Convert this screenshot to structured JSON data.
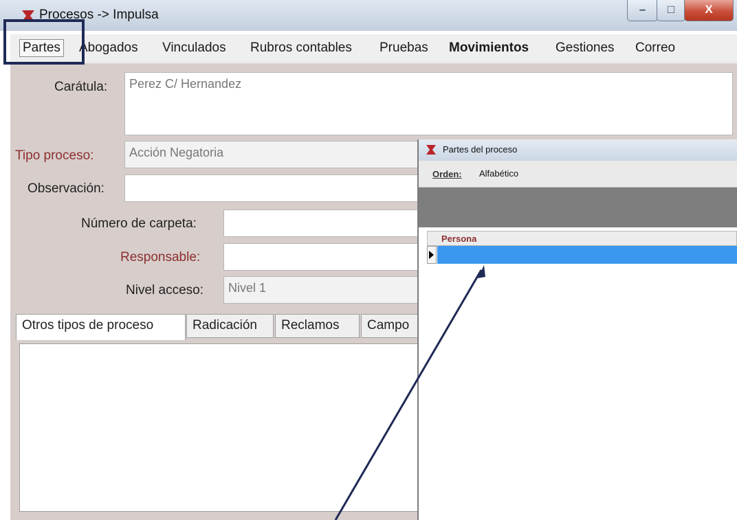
{
  "window": {
    "title": "Procesos -> Impulsa",
    "controls": {
      "minimize": "–",
      "maximize": "□",
      "close": "X"
    }
  },
  "menu": {
    "items": [
      {
        "label": "Partes",
        "bold": false
      },
      {
        "label": "Abogados",
        "bold": false
      },
      {
        "label": "Vinculados",
        "bold": false
      },
      {
        "label": "Rubros contables",
        "bold": false
      },
      {
        "label": "Pruebas",
        "bold": false
      },
      {
        "label": "Movimientos",
        "bold": true
      },
      {
        "label": "Gestiones",
        "bold": false
      },
      {
        "label": "Correo",
        "bold": false
      }
    ]
  },
  "form": {
    "caratula": {
      "label": "Carátula:",
      "value": "Perez C/ Hernandez"
    },
    "tipo_proceso": {
      "label": "Tipo proceso:",
      "value": "Acción Negatoria"
    },
    "observacion": {
      "label": "Observación:",
      "value": ""
    },
    "numero_carpeta": {
      "label": "Número de carpeta:",
      "value": ""
    },
    "responsable": {
      "label": "Responsable:",
      "value": ""
    },
    "nivel_acceso": {
      "label": "Nivel acceso:",
      "value": "Nivel 1"
    }
  },
  "tabs": [
    {
      "label": "Otros tipos de proceso",
      "active": true
    },
    {
      "label": "Radicación",
      "active": false
    },
    {
      "label": "Reclamos",
      "active": false
    },
    {
      "label": "Campo",
      "active": false
    }
  ],
  "dialog": {
    "title": "Partes del proceso",
    "orden_label": "Orden:",
    "orden_value": "Alfabético",
    "grid": {
      "columns": [
        "Persona"
      ],
      "rows": [
        ""
      ]
    }
  },
  "colors": {
    "annotation": "#1f2a55",
    "selection": "#3b98ee",
    "panel": "#d7cecb",
    "required_label": "#8d2f2f"
  }
}
